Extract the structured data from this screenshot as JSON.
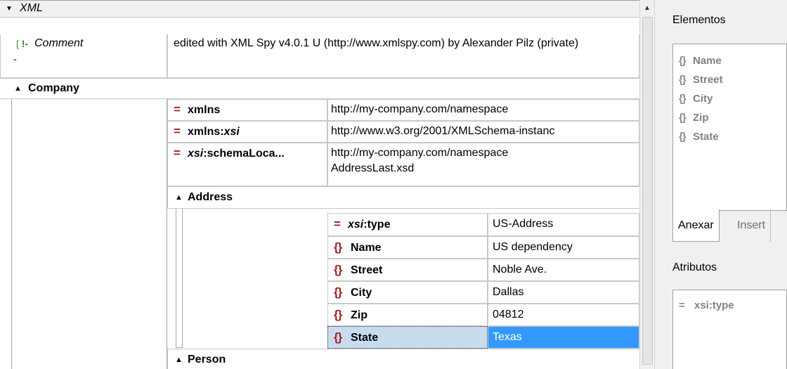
{
  "xml": {
    "label": "XML"
  },
  "comment": {
    "label": "Comment",
    "text": "edited with XML Spy v4.0.1 U (http://www.xmlspy.com) by Alexander Pilz (private)"
  },
  "company": {
    "label": "Company",
    "attributes": [
      {
        "name_prefix": "",
        "name_main": "xmlns",
        "name_suffix": "",
        "value": "http://my-company.com/namespace"
      },
      {
        "name_prefix": "",
        "name_main": "xmlns:",
        "name_suffix": "xsi",
        "value": "http://www.w3.org/2001/XMLSchema-instanc"
      },
      {
        "name_prefix": "xsi",
        "name_main": ":schemaLoca...",
        "name_suffix": "",
        "value": "http://my-company.com/namespace AddressLast.xsd"
      }
    ],
    "address": {
      "label": "Address",
      "rows": [
        {
          "kind": "attribute",
          "prefix": "xsi",
          "name": ":type",
          "value": "US-Address"
        },
        {
          "kind": "element",
          "prefix": "",
          "name": "Name",
          "value": "US dependency"
        },
        {
          "kind": "element",
          "prefix": "",
          "name": "Street",
          "value": "Noble Ave."
        },
        {
          "kind": "element",
          "prefix": "",
          "name": "City",
          "value": "Dallas"
        },
        {
          "kind": "element",
          "prefix": "",
          "name": "Zip",
          "value": "04812"
        },
        {
          "kind": "element",
          "prefix": "",
          "name": "State",
          "value": "Texas"
        }
      ]
    },
    "person": {
      "label": "Person"
    }
  },
  "side": {
    "elements_title": "Elementos",
    "elements": [
      "Name",
      "Street",
      "City",
      "Zip",
      "State"
    ],
    "tabs": [
      "Anexar",
      "Insert"
    ],
    "attributes_title": "Atributos",
    "attributes": [
      "xsi:type"
    ]
  },
  "colors": {
    "selection": "#3399ff",
    "brace": "#a0201c",
    "comment_icon": "#2a8a2a"
  }
}
